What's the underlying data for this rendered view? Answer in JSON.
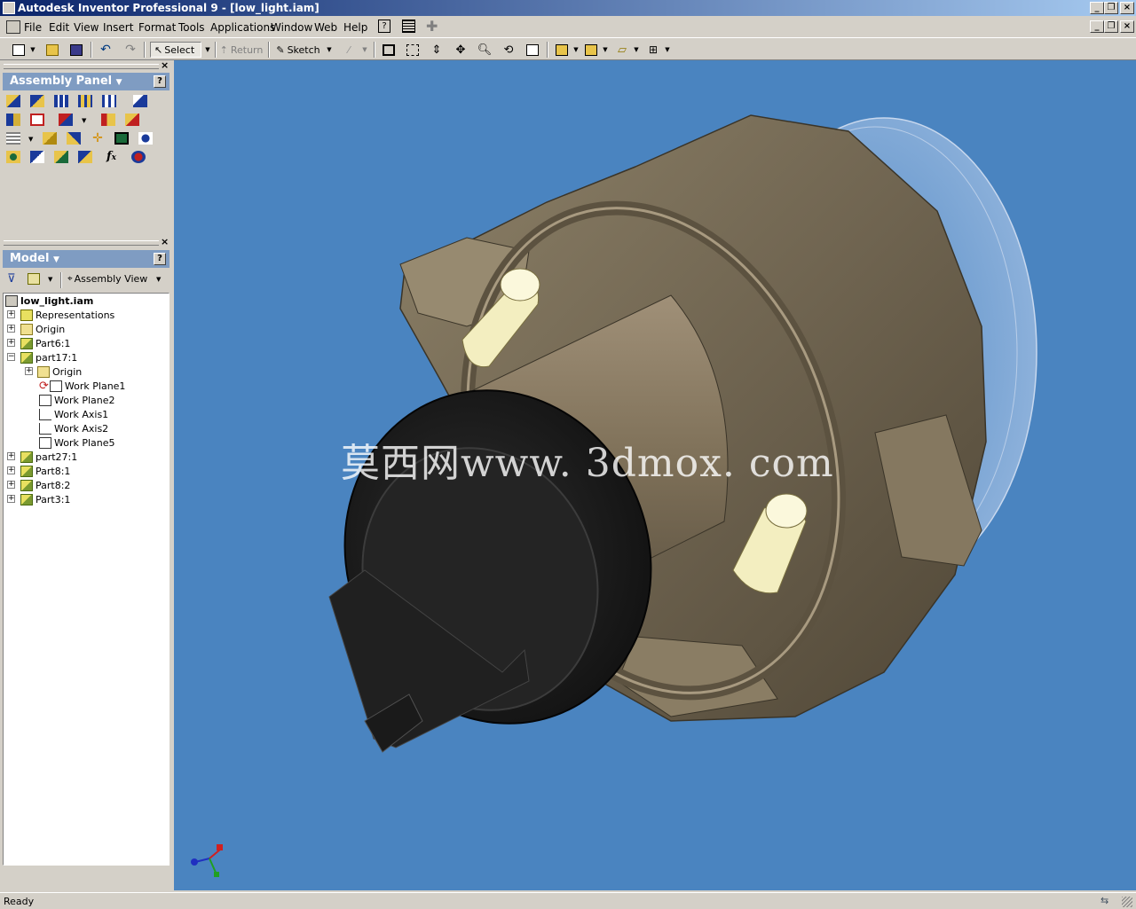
{
  "window": {
    "title": "Autodesk Inventor Professional 9 - [low_light.iam]",
    "min_icon": "minimize-icon",
    "max_icon": "restore-icon",
    "close_icon": "close-icon"
  },
  "menu": [
    "File",
    "Edit",
    "View",
    "Insert",
    "Format",
    "Tools",
    "Applications",
    "Window",
    "Web",
    "Help"
  ],
  "toolbar": {
    "select_label": "Select",
    "return_label": "Return",
    "sketch_label": "Sketch",
    "combo_value": ""
  },
  "assembly_panel": {
    "title": "Assembly Panel",
    "help": "?"
  },
  "model_panel": {
    "title": "Model",
    "help": "?",
    "view_label": "Assembly View"
  },
  "tree": {
    "root": "low_light.iam",
    "items": [
      {
        "label": "Representations"
      },
      {
        "label": "Origin"
      },
      {
        "label": "Part6:1"
      },
      {
        "label": "part17:1"
      },
      {
        "label": "Origin"
      },
      {
        "label": "Work Plane1"
      },
      {
        "label": "Work Plane2"
      },
      {
        "label": "Work Axis1"
      },
      {
        "label": "Work Axis2"
      },
      {
        "label": "Work Plane5"
      },
      {
        "label": "part27:1"
      },
      {
        "label": "Part8:1"
      },
      {
        "label": "Part8:2"
      },
      {
        "label": "Part3:1"
      }
    ]
  },
  "viewport": {
    "watermark": "莫西网www. 3dmox. com"
  },
  "status": {
    "text": "Ready"
  },
  "colors": {
    "viewport_bg": "#4a84c0",
    "panel_header": "#7f9cc2",
    "title_active": "#0a246a"
  }
}
